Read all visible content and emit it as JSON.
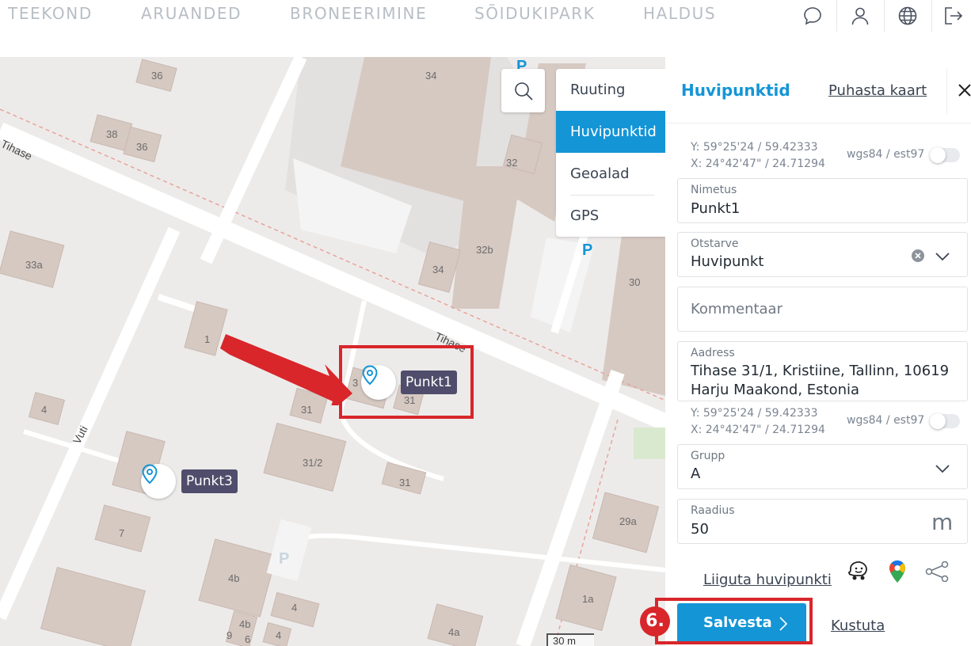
{
  "nav": {
    "items": [
      "TEEKOND",
      "ARUANDED",
      "BRONEERIMINE",
      "SÕIDUKIPARK",
      "HALDUS"
    ]
  },
  "map": {
    "street_labels": [
      "Tihase",
      "Tihase",
      "Vuti"
    ],
    "house_numbers": [
      "36",
      "38",
      "36",
      "34",
      "32",
      "32b",
      "34",
      "30",
      "33a",
      "1",
      "3",
      "31",
      "31",
      "31/2",
      "31",
      "4",
      "7",
      "4b",
      "4",
      "4b",
      "9",
      "6",
      "4",
      "4a",
      "1a",
      "29a"
    ],
    "parking_label": "P",
    "scale_label": "30 m",
    "pins": [
      {
        "label": "Punkt1"
      },
      {
        "label": "Punkt3"
      }
    ]
  },
  "menu": {
    "items": [
      {
        "label": "Ruuting",
        "active": false
      },
      {
        "label": "Huvipunktid",
        "active": true
      },
      {
        "label": "Geoalad",
        "active": false
      },
      {
        "label": "GPS",
        "active": false
      }
    ]
  },
  "panel": {
    "title": "Huvipunktid",
    "clear_map": "Puhasta kaart",
    "coords_top": {
      "y": "Y: 59°25'24 / 59.42333",
      "x": "X: 24°42'47\" / 24.71294"
    },
    "projection": "wgs84 / est97",
    "name": {
      "label": "Nimetus",
      "value": "Punkt1"
    },
    "shortcut": {
      "label": "Otstarve",
      "value": "Huvipunkt"
    },
    "comment": {
      "placeholder": "Kommentaar"
    },
    "address": {
      "label": "Aadress",
      "line1": "Tihase 31/1, Kristiine, Tallinn, 10619",
      "line2": "Harju Maakond, Estonia"
    },
    "coords_bottom": {
      "y": "Y: 59°25'24 / 59.42333",
      "x": "X: 24°42'47\" / 24.71294"
    },
    "group": {
      "label": "Grupp",
      "value": "A"
    },
    "radius": {
      "label": "Raadius",
      "value": "50",
      "unit": "m"
    },
    "move_link": "Liiguta huvipunkti",
    "save": "Salvesta",
    "delete": "Kustuta"
  },
  "annotation": {
    "step": "6."
  },
  "colors": {
    "accent": "#1495d6",
    "highlight": "#d8262a",
    "pin_label_bg": "#4f4d6b"
  }
}
